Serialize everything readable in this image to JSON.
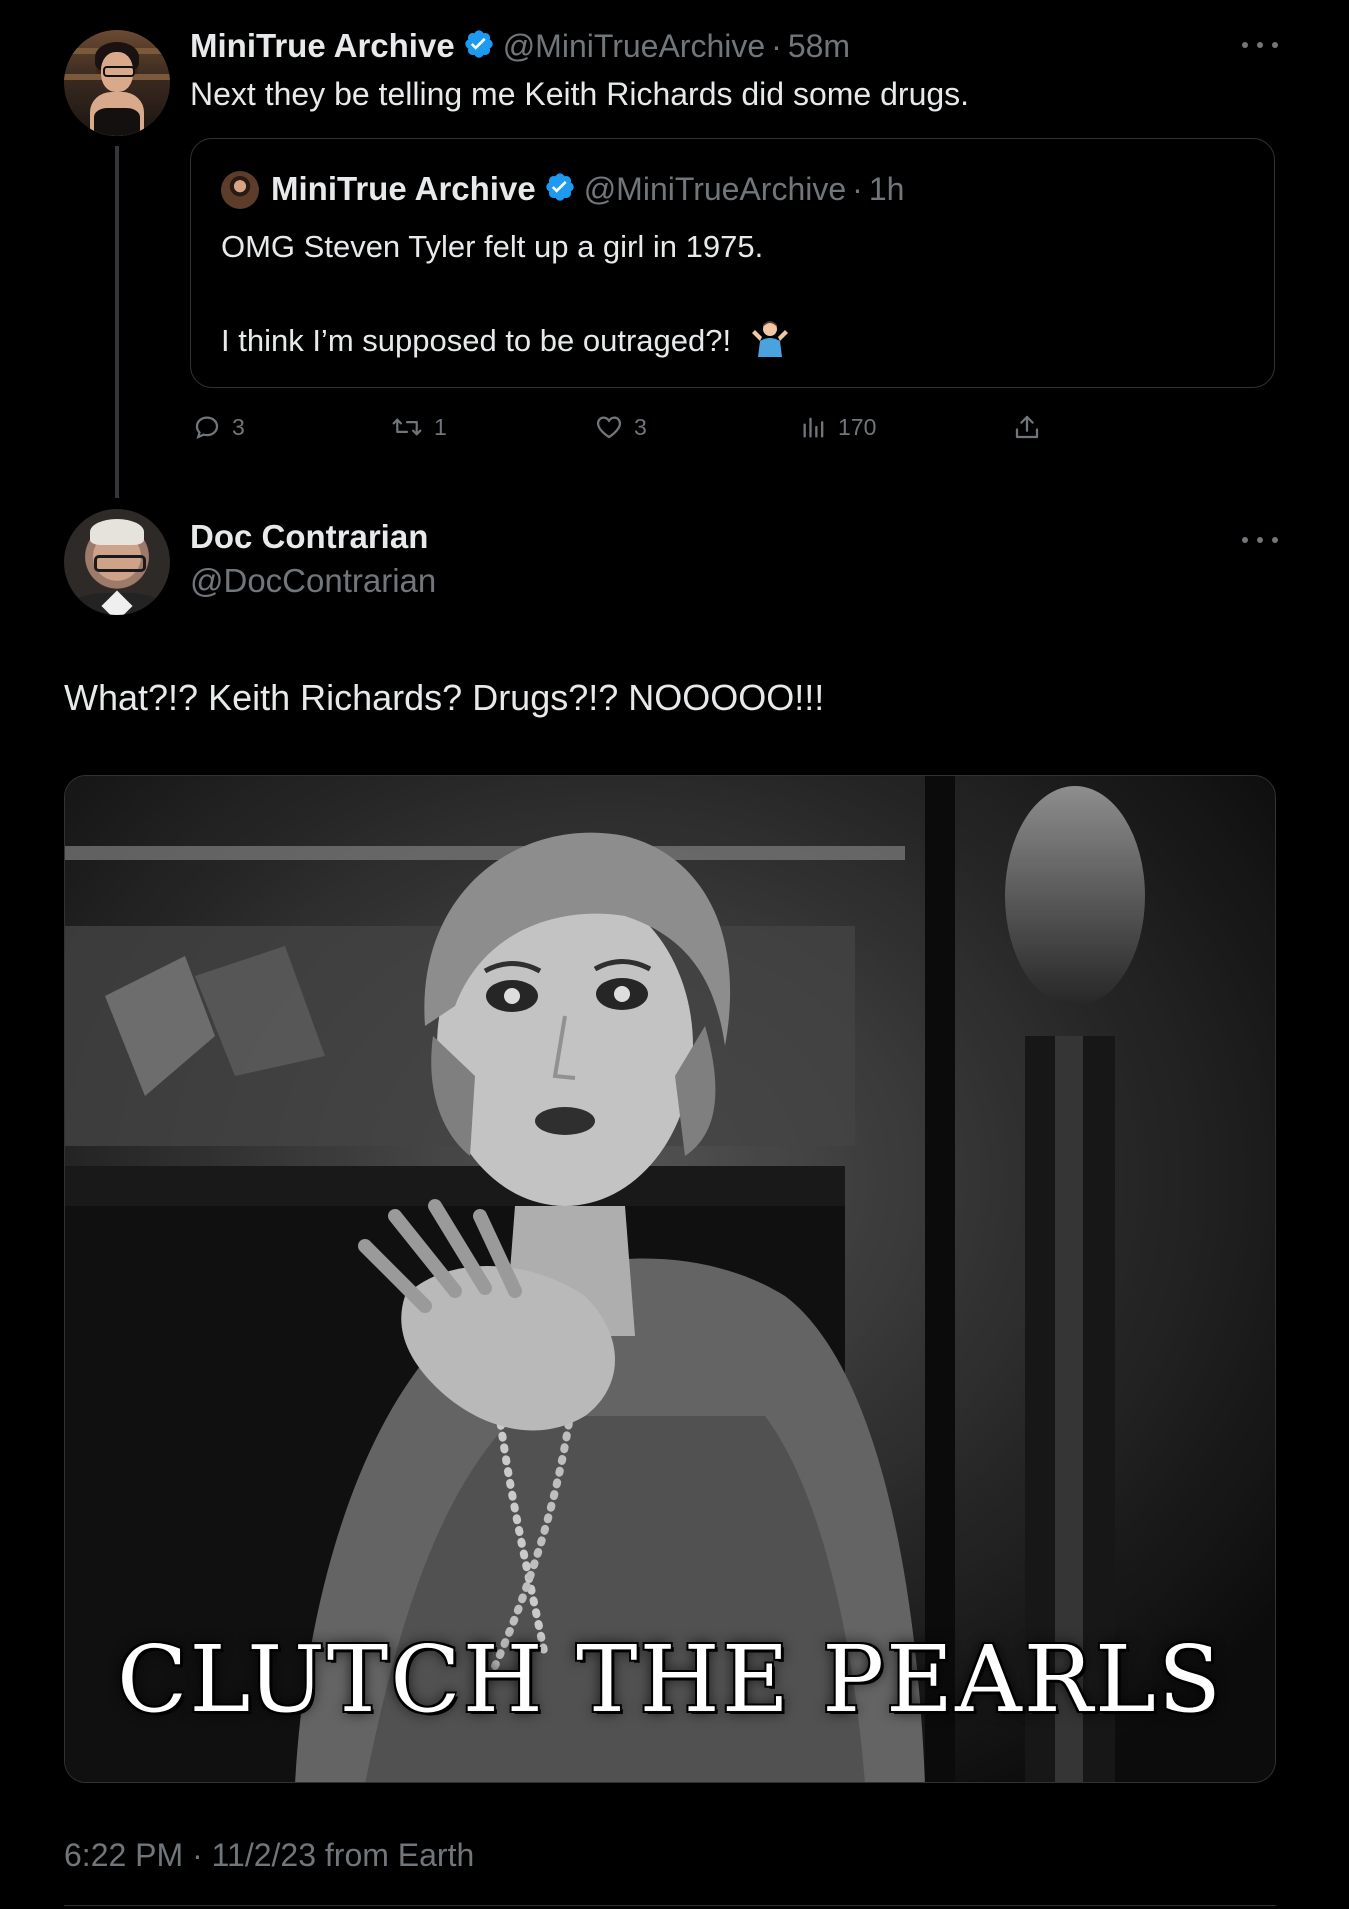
{
  "theme": {
    "background": "#000000",
    "text": "#e7e9ea",
    "muted": "#71767b",
    "verified_badge": "#1d9bf0",
    "border": "#2f3336"
  },
  "parent_tweet": {
    "author_name": "MiniTrue Archive",
    "handle": "@MiniTrueArchive",
    "separator": "·",
    "time": "58m",
    "text": "Next they be telling me Keith Richards did some drugs.",
    "quote": {
      "author_name": "MiniTrue Archive",
      "handle": "@MiniTrueArchive",
      "separator": "·",
      "time": "1h",
      "line1": "OMG Steven Tyler felt up a girl in 1975.",
      "line2": "I think I’m supposed to be outraged?!"
    },
    "actions": {
      "replies": "3",
      "reposts": "1",
      "likes": "3",
      "views": "170"
    }
  },
  "reply_tweet": {
    "author_name": "Doc Contrarian",
    "handle": "@DocContrarian",
    "text": "What?!? Keith Richards? Drugs?!? NOOOOO!!!",
    "media_caption": "CLUTCH THE PEARLS",
    "timestamp": "6:22 PM · 11/2/23 from Earth"
  },
  "icons": {
    "verified": "verified-badge-icon",
    "more": "more-horizontal-icon",
    "reply": "reply-bubble-icon",
    "repost": "repost-icon",
    "like": "heart-icon",
    "views": "views-chart-icon",
    "share": "share-upload-icon",
    "shrug": "person-shrugging-emoji"
  }
}
